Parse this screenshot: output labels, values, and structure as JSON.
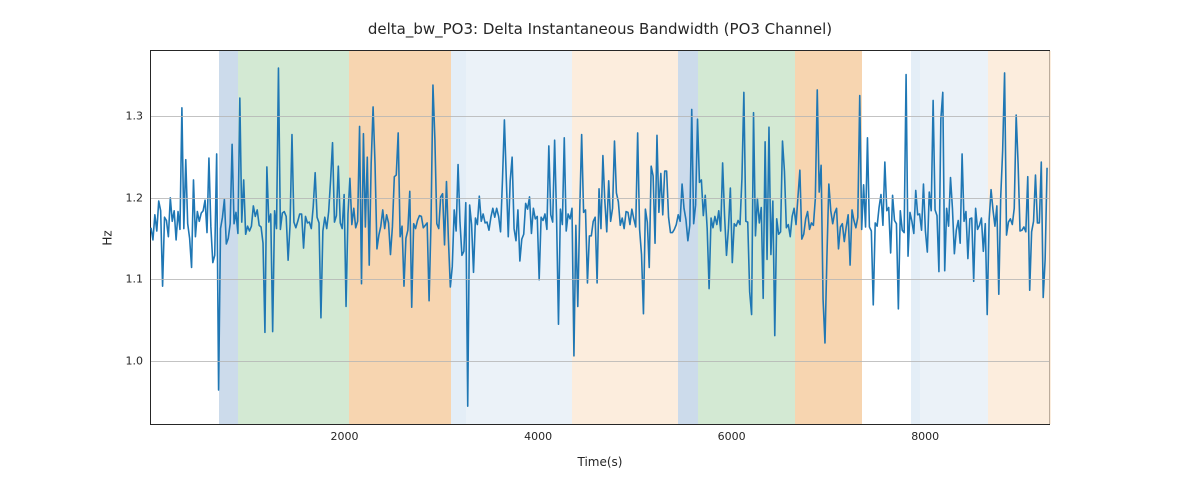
{
  "chart_data": {
    "type": "line",
    "title": "delta_bw_PO3: Delta Instantaneous Bandwidth (PO3 Channel)",
    "xlabel": "Time(s)",
    "ylabel": "Hz",
    "xlim": [
      0,
      9300
    ],
    "ylim": [
      0.92,
      1.38
    ],
    "xticks": [
      2000,
      4000,
      6000,
      8000
    ],
    "yticks": [
      1.0,
      1.1,
      1.2,
      1.3
    ],
    "line_color": "#1f77b4",
    "bands": [
      {
        "x0": 700,
        "x1": 900,
        "color": "#b7cce2",
        "alpha": 0.7
      },
      {
        "x0": 900,
        "x1": 2050,
        "color": "#c1e0c1",
        "alpha": 0.7
      },
      {
        "x0": 2050,
        "x1": 3100,
        "color": "#f4c38f",
        "alpha": 0.7
      },
      {
        "x0": 3100,
        "x1": 3250,
        "color": "#d9e7f3",
        "alpha": 0.7
      },
      {
        "x0": 3250,
        "x1": 4350,
        "color": "#dee9f3",
        "alpha": 0.6
      },
      {
        "x0": 4350,
        "x1": 5450,
        "color": "#fbe6ce",
        "alpha": 0.7
      },
      {
        "x0": 5450,
        "x1": 5650,
        "color": "#b7cce2",
        "alpha": 0.7
      },
      {
        "x0": 5650,
        "x1": 6650,
        "color": "#c1e0c1",
        "alpha": 0.7
      },
      {
        "x0": 6650,
        "x1": 7350,
        "color": "#f4c38f",
        "alpha": 0.7
      },
      {
        "x0": 7850,
        "x1": 7950,
        "color": "#d9e7f3",
        "alpha": 0.7
      },
      {
        "x0": 7950,
        "x1": 8650,
        "color": "#dee9f3",
        "alpha": 0.6
      },
      {
        "x0": 8650,
        "x1": 9300,
        "color": "#fbe6ce",
        "alpha": 0.7
      }
    ],
    "series": [
      {
        "name": "delta_bw_PO3",
        "x_step": 20,
        "x_start": 0,
        "values": [
          1.162,
          1.147,
          1.178,
          1.158,
          1.195,
          1.183,
          1.09,
          1.175,
          1.171,
          1.151,
          1.199,
          1.17,
          1.183,
          1.147,
          1.182,
          1.16,
          1.31,
          1.161,
          1.246,
          1.167,
          1.149,
          1.113,
          1.221,
          1.151,
          1.182,
          1.17,
          1.18,
          1.183,
          1.196,
          1.156,
          1.248,
          1.163,
          1.119,
          1.128,
          1.253,
          0.962,
          1.161,
          1.175,
          1.197,
          1.142,
          1.149,
          1.167,
          1.265,
          1.167,
          1.181,
          1.155,
          1.322,
          1.169,
          1.221,
          1.154,
          1.164,
          1.158,
          1.164,
          1.189,
          1.176,
          1.184,
          1.165,
          1.163,
          1.143,
          1.033,
          1.237,
          1.169,
          1.179,
          1.034,
          1.183,
          1.161,
          1.359,
          1.16,
          1.18,
          1.182,
          1.176,
          1.122,
          1.165,
          1.277,
          1.169,
          1.162,
          1.17,
          1.179,
          1.179,
          1.137,
          1.176,
          1.168,
          1.169,
          1.161,
          1.188,
          1.23,
          1.175,
          1.168,
          1.051,
          1.158,
          1.175,
          1.161,
          1.182,
          1.221,
          1.267,
          1.169,
          1.177,
          1.238,
          1.168,
          1.161,
          1.203,
          1.065,
          1.179,
          1.223,
          1.166,
          1.186,
          1.162,
          1.17,
          1.287,
          1.093,
          1.278,
          1.163,
          1.249,
          1.116,
          1.241,
          1.311,
          1.241,
          1.136,
          1.153,
          1.164,
          1.184,
          1.161,
          1.178,
          1.168,
          1.129,
          1.163,
          1.225,
          1.227,
          1.279,
          1.151,
          1.164,
          1.09,
          1.149,
          1.159,
          1.207,
          1.064,
          1.167,
          1.161,
          1.171,
          1.177,
          1.176,
          1.162,
          1.165,
          1.168,
          1.072,
          1.17,
          1.338,
          1.271,
          1.167,
          1.161,
          1.2,
          1.204,
          1.141,
          1.219,
          1.148,
          1.089,
          1.114,
          1.184,
          1.158,
          1.24,
          1.169,
          1.128,
          1.133,
          1.193,
          0.942,
          1.19,
          1.166,
          1.107,
          1.174,
          1.166,
          1.201,
          1.17,
          1.179,
          1.168,
          1.169,
          1.159,
          1.175,
          1.186,
          1.175,
          1.186,
          1.176,
          1.157,
          1.221,
          1.295,
          1.221,
          1.151,
          1.22,
          1.249,
          1.161,
          1.146,
          1.184,
          1.121,
          1.148,
          1.154,
          1.192,
          1.185,
          1.2,
          1.155,
          1.186,
          1.173,
          1.176,
          1.098,
          1.175,
          1.171,
          1.179,
          1.16,
          1.263,
          1.178,
          1.169,
          1.27,
          1.176,
          1.043,
          1.185,
          1.166,
          1.273,
          1.158,
          1.179,
          1.173,
          1.186,
          1.004,
          1.165,
          1.065,
          1.182,
          1.277,
          1.181,
          1.184,
          1.094,
          1.152,
          1.152,
          1.17,
          1.175,
          1.094,
          1.21,
          1.161,
          1.251,
          1.195,
          1.157,
          1.22,
          1.17,
          1.186,
          1.269,
          1.205,
          1.194,
          1.165,
          1.174,
          1.161,
          1.182,
          1.181,
          1.166,
          1.185,
          1.173,
          1.163,
          1.279,
          1.16,
          1.129,
          1.056,
          1.185,
          1.169,
          1.113,
          1.238,
          1.226,
          1.143,
          1.276,
          1.181,
          1.229,
          1.178,
          1.232,
          1.232,
          1.175,
          1.156,
          1.156,
          1.16,
          1.166,
          1.178,
          1.17,
          1.216,
          1.186,
          1.172,
          1.146,
          1.165,
          1.308,
          1.167,
          1.19,
          1.296,
          1.218,
          1.221,
          1.177,
          1.202,
          1.161,
          1.087,
          1.174,
          1.162,
          1.176,
          1.166,
          1.183,
          1.158,
          1.242,
          1.177,
          1.128,
          1.161,
          1.211,
          1.119,
          1.167,
          1.164,
          1.171,
          1.166,
          1.223,
          1.329,
          1.17,
          1.169,
          1.083,
          1.055,
          1.304,
          1.152,
          1.198,
          1.168,
          1.187,
          1.075,
          1.268,
          1.123,
          1.286,
          1.129,
          1.195,
          1.029,
          1.173,
          1.154,
          1.157,
          1.269,
          1.232,
          1.162,
          1.166,
          1.151,
          1.176,
          1.186,
          1.166,
          1.2,
          1.233,
          1.148,
          1.154,
          1.173,
          1.182,
          1.16,
          1.168,
          1.165,
          1.198,
          1.332,
          1.206,
          1.239,
          1.074,
          1.02,
          1.126,
          1.216,
          1.183,
          1.167,
          1.18,
          1.186,
          1.136,
          1.163,
          1.167,
          1.145,
          1.163,
          1.178,
          1.116,
          1.184,
          1.171,
          1.162,
          1.175,
          1.325,
          1.16,
          1.215,
          1.163,
          1.273,
          1.163,
          1.158,
          1.067,
          1.168,
          1.164,
          1.187,
          1.203,
          1.165,
          1.243,
          1.183,
          1.187,
          1.131,
          1.202,
          1.171,
          1.167,
          1.062,
          1.183,
          1.159,
          1.156,
          1.351,
          1.127,
          1.181,
          1.17,
          1.155,
          1.208,
          1.178,
          1.179,
          1.159,
          1.216,
          1.158,
          1.132,
          1.206,
          1.183,
          1.319,
          1.184,
          1.177,
          1.108,
          1.296,
          1.329,
          1.109,
          1.186,
          1.164,
          1.224,
          1.186,
          1.13,
          1.159,
          1.171,
          1.143,
          1.253,
          1.17,
          1.182,
          1.124,
          1.173,
          1.174,
          1.096,
          1.186,
          1.16,
          1.165,
          1.174,
          1.133,
          1.167,
          1.055,
          1.172,
          1.209,
          1.184,
          1.164,
          1.189,
          1.08,
          1.2,
          1.257,
          1.353,
          1.153,
          1.169,
          1.173,
          1.166,
          1.186,
          1.301,
          1.241,
          1.158,
          1.159,
          1.163,
          1.157,
          1.225,
          1.085,
          1.157,
          1.17,
          1.227,
          1.168,
          1.168,
          1.243,
          1.076,
          1.123,
          1.236
        ]
      }
    ]
  }
}
